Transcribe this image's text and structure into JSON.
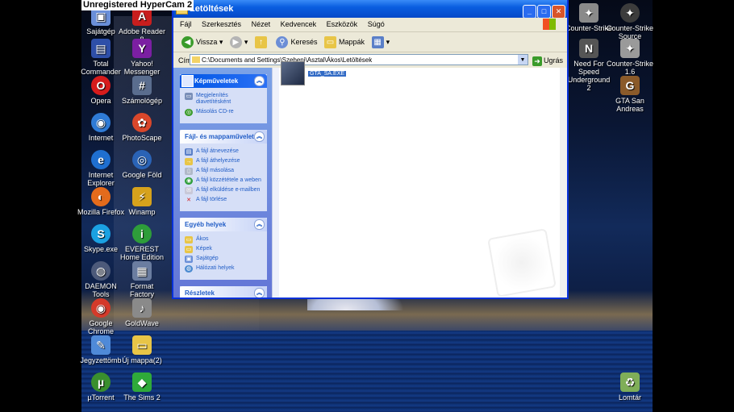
{
  "watermark": "Unregistered HyperCam 2",
  "desktop_icons_left": [
    {
      "label": "Sajátgép",
      "col": 0
    },
    {
      "label": "Adobe Reader 8",
      "col": 1
    },
    {
      "label": "Total Commander",
      "col": 0
    },
    {
      "label": "Yahoo! Messenger",
      "col": 1
    },
    {
      "label": "Opera",
      "col": 0
    },
    {
      "label": "Számológép",
      "col": 1
    },
    {
      "label": "Internet",
      "col": 0
    },
    {
      "label": "PhotoScape",
      "col": 1
    },
    {
      "label": "Internet Explorer",
      "col": 0
    },
    {
      "label": "Google Föld",
      "col": 1
    },
    {
      "label": "Mozilla Firefox",
      "col": 0
    },
    {
      "label": "Winamp",
      "col": 1
    },
    {
      "label": "Skype.exe",
      "col": 0
    },
    {
      "label": "EVEREST Home Edition",
      "col": 1
    },
    {
      "label": "DAEMON Tools",
      "col": 0
    },
    {
      "label": "Format Factory",
      "col": 1
    },
    {
      "label": "Google Chrome",
      "col": 0
    },
    {
      "label": "GoldWave",
      "col": 1
    },
    {
      "label": "Jegyzettömb",
      "col": 0
    },
    {
      "label": "Új mappa(2)",
      "col": 1
    },
    {
      "label": "µTorrent",
      "col": 0
    },
    {
      "label": "The Sims 2",
      "col": 1
    }
  ],
  "desktop_icons_right": [
    {
      "label": "Counter-Strike"
    },
    {
      "label": "Counter-Strike Source"
    },
    {
      "label": "Need For Speed Underground 2"
    },
    {
      "label": "Counter-Strike 1.6"
    },
    {
      "label": "GTA San Andreas"
    },
    {
      "label": "Lomtár"
    }
  ],
  "window": {
    "title": "Letöltések",
    "menu": [
      "Fájl",
      "Szerkesztés",
      "Nézet",
      "Kedvencek",
      "Eszközök",
      "Súgó"
    ],
    "toolbar": {
      "back": "Vissza",
      "search": "Keresés",
      "folders": "Mappák"
    },
    "address_label": "Cím",
    "address_value": "C:\\Documents and Settings\\Szebeni\\Asztal\\Ákos\\Letöltések",
    "go_label": "Ugrás",
    "panels": [
      {
        "title": "Képműveletek",
        "items": [
          "Megjelenítés diavetítésként",
          "Másolás CD-re"
        ]
      },
      {
        "title": "Fájl- és mappaművelet",
        "items": [
          "A fájl átnevezése",
          "A fájl áthelyezése",
          "A fájl másolása",
          "A fájl közzététele a weben",
          "A fájl elküldése e-mailben",
          "A fájl törlése"
        ]
      },
      {
        "title": "Egyéb helyek",
        "items": [
          "Ákos",
          "Képek",
          "Sajátgép",
          "Hálózati helyek"
        ]
      },
      {
        "title": "Részletek",
        "items": []
      }
    ],
    "file": {
      "name": "GTA_SA.EXE"
    }
  }
}
